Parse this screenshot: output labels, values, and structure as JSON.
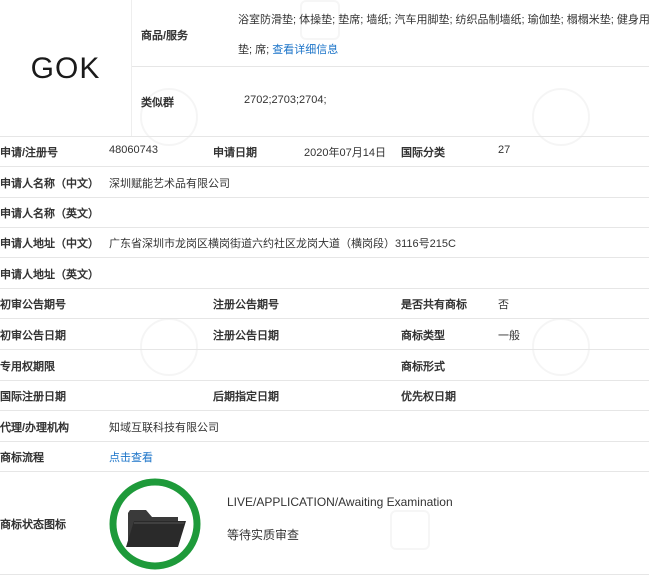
{
  "logo": {
    "text": "GOK"
  },
  "goods": {
    "label": "商品/服务",
    "text_line1": "浴室防滑垫; 体操垫; 垫席; 墙纸; 汽车用脚垫; 纺织品制墙纸; 瑜伽垫; 榻榻米垫; 健身用",
    "text_line2": "垫; 席;",
    "link": "查看详细信息"
  },
  "similar_group": {
    "label": "类似群",
    "value": "2702;2703;2704;"
  },
  "rows": {
    "reg_no_label": "申请/注册号",
    "reg_no": "48060743",
    "apply_date_label": "申请日期",
    "apply_date": "2020年07月14日",
    "intl_class_label": "国际分类",
    "intl_class": "27",
    "applicant_cn_label": "申请人名称（中文）",
    "applicant_cn": "深圳赋能艺术品有限公司",
    "applicant_en_label": "申请人名称（英文）",
    "address_cn_label": "申请人地址（中文）",
    "address_cn": "广东省深圳市龙岗区横岗街道六约社区龙岗大道（横岗段）3116号215C",
    "address_en_label": "申请人地址（英文）",
    "prelim_issue_label": "初审公告期号",
    "reg_issue_label": "注册公告期号",
    "shared_label": "是否共有商标",
    "shared": "否",
    "prelim_date_label": "初审公告日期",
    "reg_date_label": "注册公告日期",
    "tm_type_label": "商标类型",
    "tm_type": "一般",
    "exclusive_label": "专用权期限",
    "tm_form_label": "商标形式",
    "intl_reg_date_label": "国际注册日期",
    "later_date_label": "后期指定日期",
    "priority_label": "优先权日期",
    "agent_label": "代理/办理机构",
    "agent": "知域互联科技有限公司",
    "process_label": "商标流程",
    "process_link": "点击查看",
    "status_label": "商标状态图标",
    "status_en": "LIVE/APPLICATION/Awaiting Examination",
    "status_cn": "等待实质审查"
  },
  "colors": {
    "link": "#1a73c8",
    "status_ring": "#1e9a3a",
    "folder": "#2a2a2a"
  },
  "icons": {
    "status": "folder-icon"
  }
}
